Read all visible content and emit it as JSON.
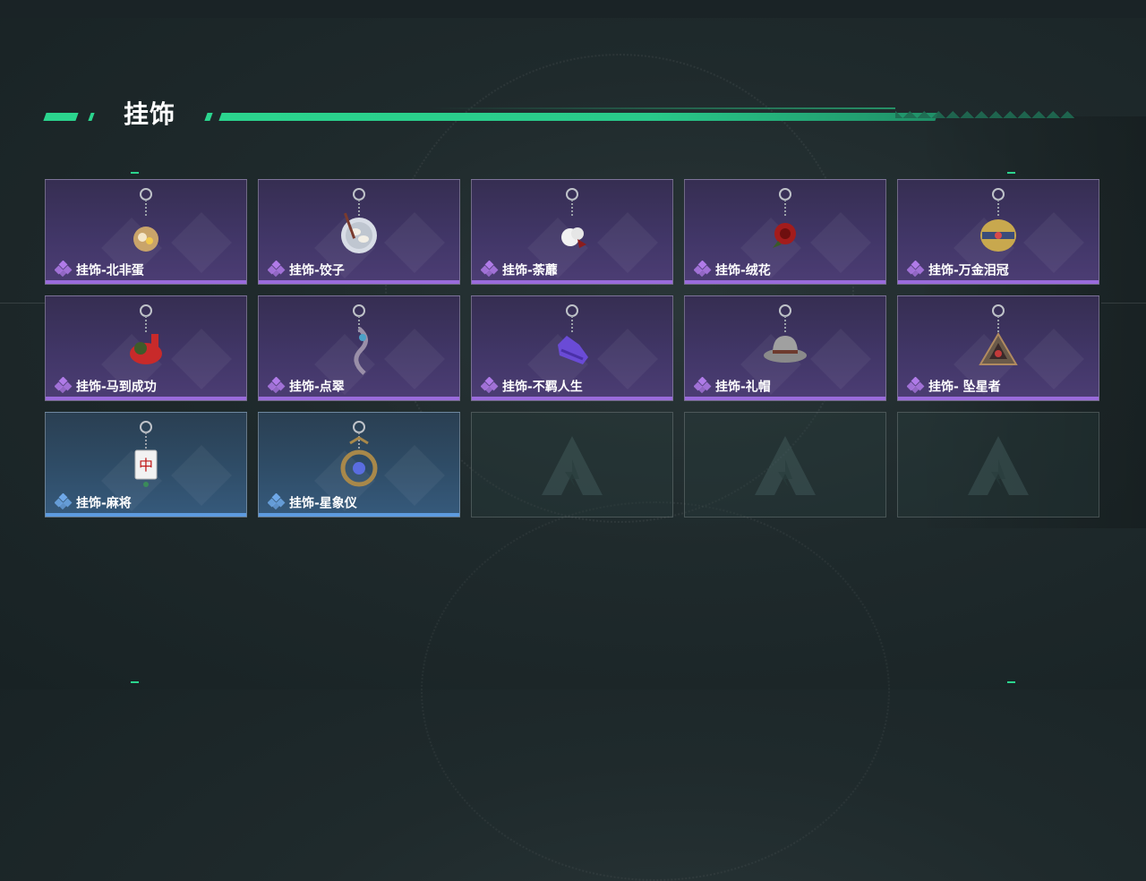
{
  "section": {
    "title": "挂饰"
  },
  "items": [
    {
      "label": "挂饰-北非蛋",
      "rarity": "purple",
      "icon": "egg-dish-charm-icon"
    },
    {
      "label": "挂饰-饺子",
      "rarity": "purple",
      "icon": "dumpling-plate-charm-icon"
    },
    {
      "label": "挂饰-荼蘼",
      "rarity": "purple",
      "icon": "flower-charm-icon"
    },
    {
      "label": "挂饰-绒花",
      "rarity": "purple",
      "icon": "red-velvet-flower-charm-icon"
    },
    {
      "label": "挂饰-万金泪冠",
      "rarity": "purple",
      "icon": "golden-crown-charm-icon"
    },
    {
      "label": "挂饰-马到成功",
      "rarity": "purple",
      "icon": "red-horse-charm-icon"
    },
    {
      "label": "挂饰-点翠",
      "rarity": "purple",
      "icon": "phoenix-hairpin-charm-icon"
    },
    {
      "label": "挂饰-不羁人生",
      "rarity": "purple",
      "icon": "sneaker-charm-icon"
    },
    {
      "label": "挂饰-礼帽",
      "rarity": "purple",
      "icon": "fedora-hat-charm-icon"
    },
    {
      "label": "挂饰- 坠星者",
      "rarity": "purple",
      "icon": "triangle-emblem-charm-icon"
    },
    {
      "label": "挂饰-麻将",
      "rarity": "blue",
      "icon": "mahjong-tile-charm-icon"
    },
    {
      "label": "挂饰-星象仪",
      "rarity": "blue",
      "icon": "astrolabe-charm-icon"
    }
  ],
  "empty_slots": 3,
  "colors": {
    "accent": "#2bd58e",
    "purple_rarity": "#9a6bdc",
    "blue_rarity": "#5d9be0"
  }
}
